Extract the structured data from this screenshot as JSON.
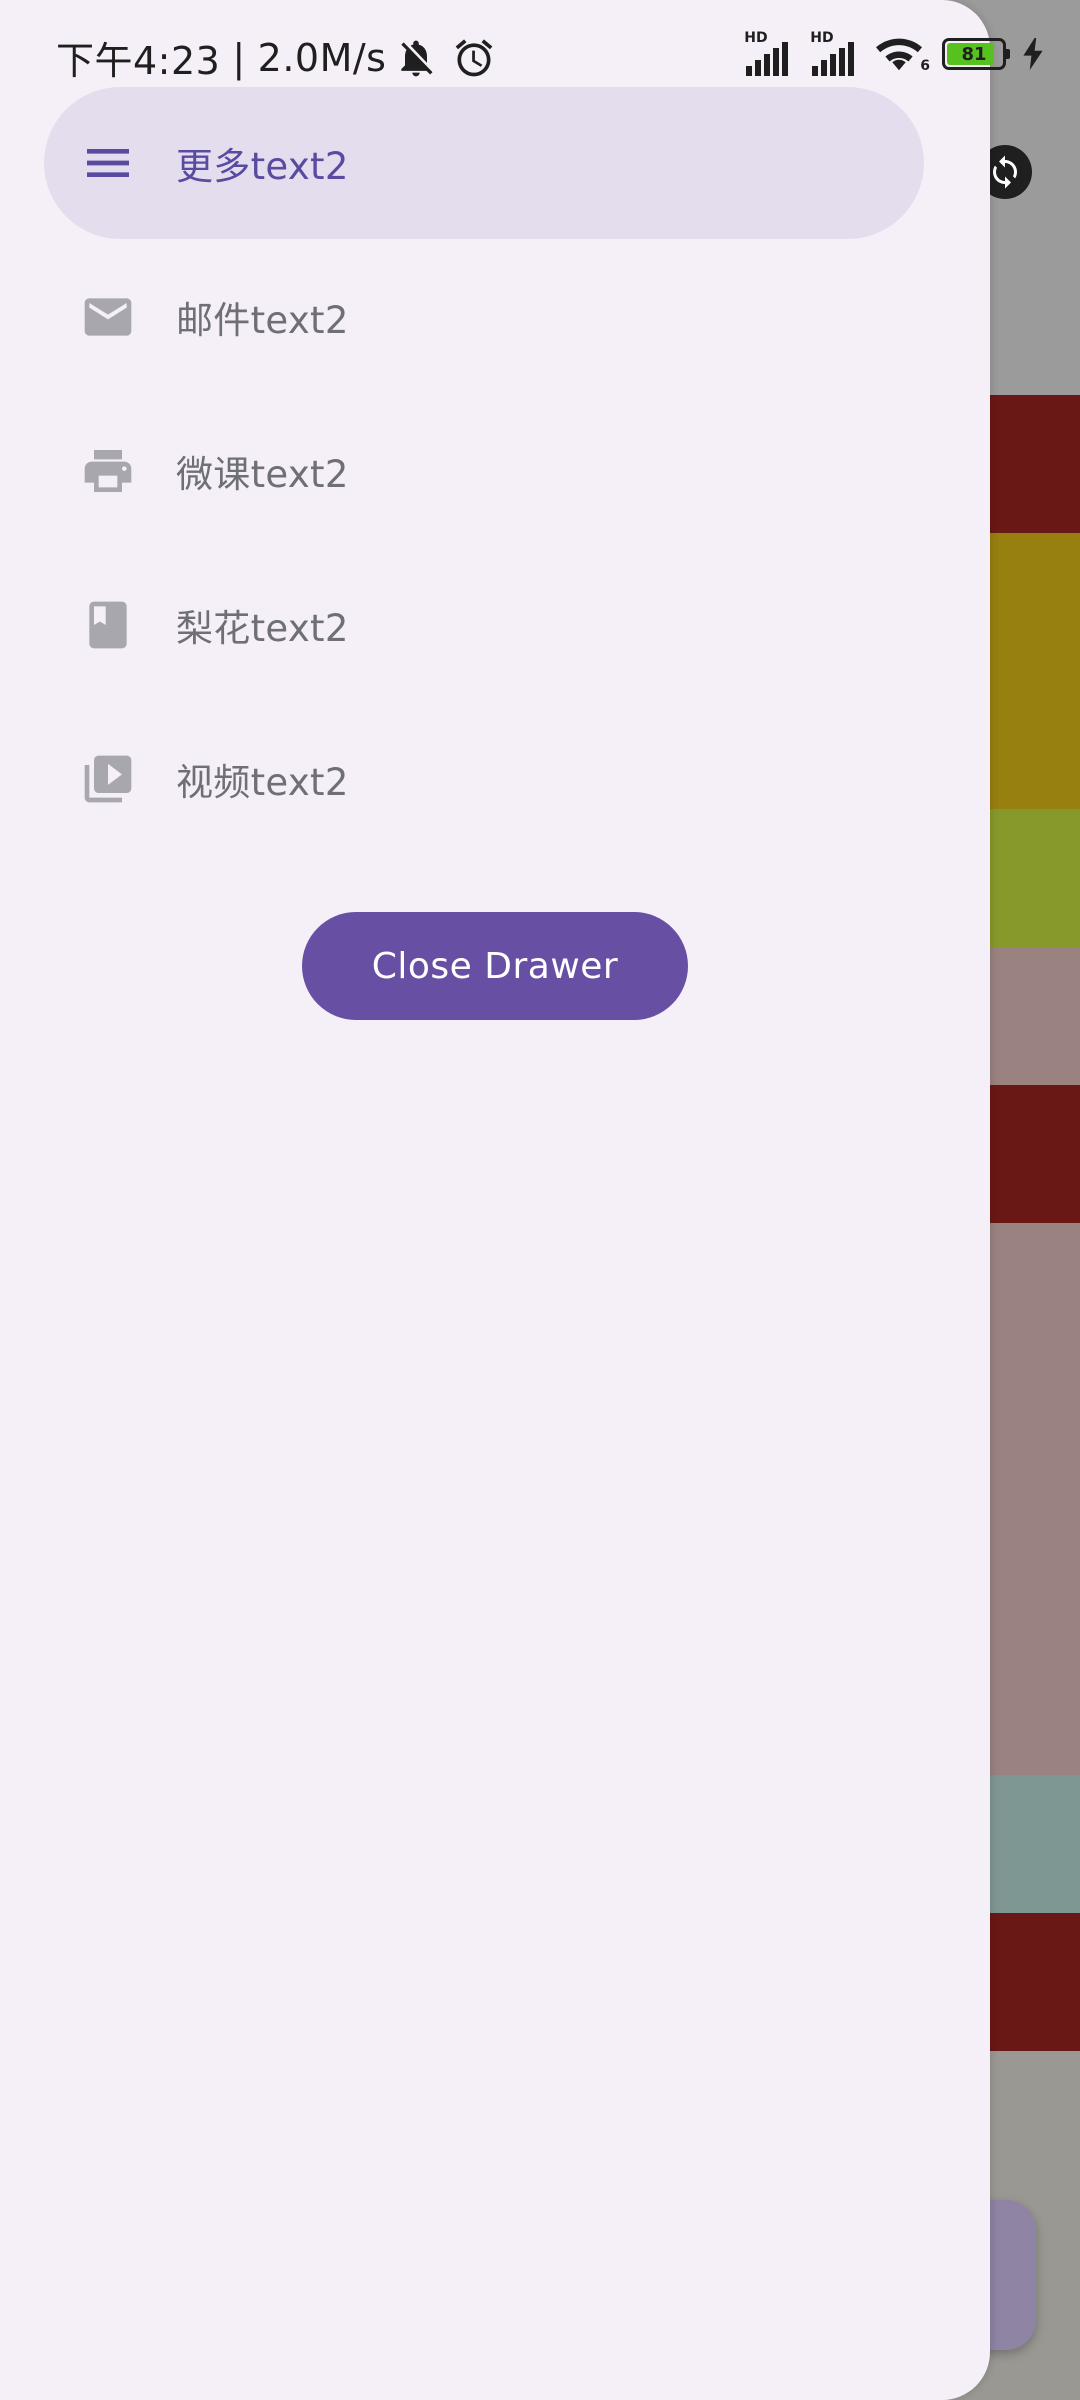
{
  "status_bar": {
    "time": "下午4:23",
    "separator": "|",
    "net_speed": "2.0M/s",
    "sim1_tag": "HD",
    "sim2_tag": "HD",
    "wifi_suffix": "6",
    "battery_level": "81",
    "icons": [
      "bell-off-icon",
      "alarm-icon",
      "signal-icon",
      "signal-icon",
      "wifi-icon",
      "battery-icon",
      "charging-icon"
    ]
  },
  "drawer": {
    "items": [
      {
        "label": "更多text2",
        "icon": "menu-icon",
        "selected": true
      },
      {
        "label": "邮件text2",
        "icon": "mail-icon",
        "selected": false
      },
      {
        "label": "微课text2",
        "icon": "print-icon",
        "selected": false
      },
      {
        "label": "梨花text2",
        "icon": "bookmark-icon",
        "selected": false
      },
      {
        "label": "视频text2",
        "icon": "video-library-icon",
        "selected": false
      }
    ],
    "close_button_label": "Close Drawer"
  },
  "colors": {
    "drawer_bg": "#f5f0f8",
    "selected_bg": "#e4ddee",
    "accent": "#6750a4",
    "icon_gray": "#a8a7ad",
    "label_gray": "#6f6f76"
  }
}
